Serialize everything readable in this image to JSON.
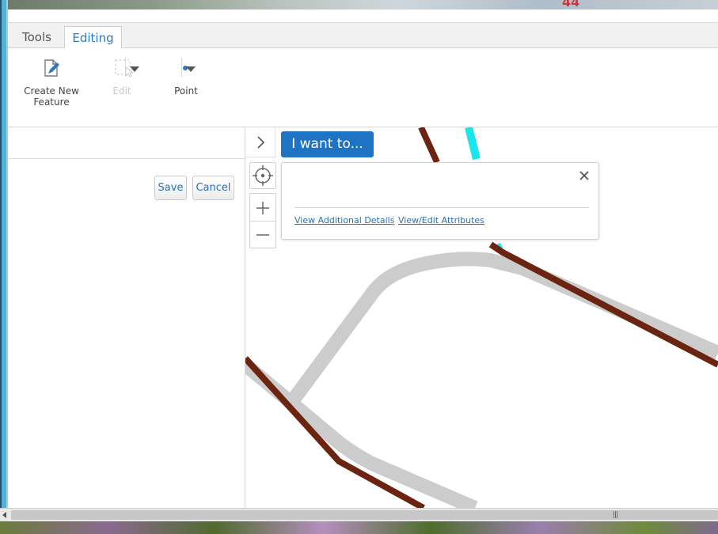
{
  "ribbon": {
    "tabs": [
      {
        "label": "Tools",
        "active": false
      },
      {
        "label": "Editing",
        "active": true
      }
    ],
    "buttons": {
      "create_new_feature": "Create New\nFeature",
      "edit": "Edit",
      "point": "Point"
    }
  },
  "top_strip": {
    "map_number": "44"
  },
  "left_panel": {
    "save_label": "Save",
    "cancel_label": "Cancel"
  },
  "map": {
    "i_want_to_label": "I want to...",
    "popup": {
      "link_details": "View Additional Details",
      "link_attributes": "View/Edit Attributes"
    }
  },
  "colors": {
    "accent": "#1f73c3",
    "link": "#2e6fb0",
    "road_brown": "#6b2410",
    "road_cyan": "#19e6ea",
    "road_gray": "#cccccc"
  },
  "icons": [
    "create-feature-icon",
    "edit-select-icon",
    "point-dot-icon",
    "chevron-right-icon",
    "locate-icon",
    "zoom-in-icon",
    "zoom-out-icon",
    "close-icon"
  ]
}
